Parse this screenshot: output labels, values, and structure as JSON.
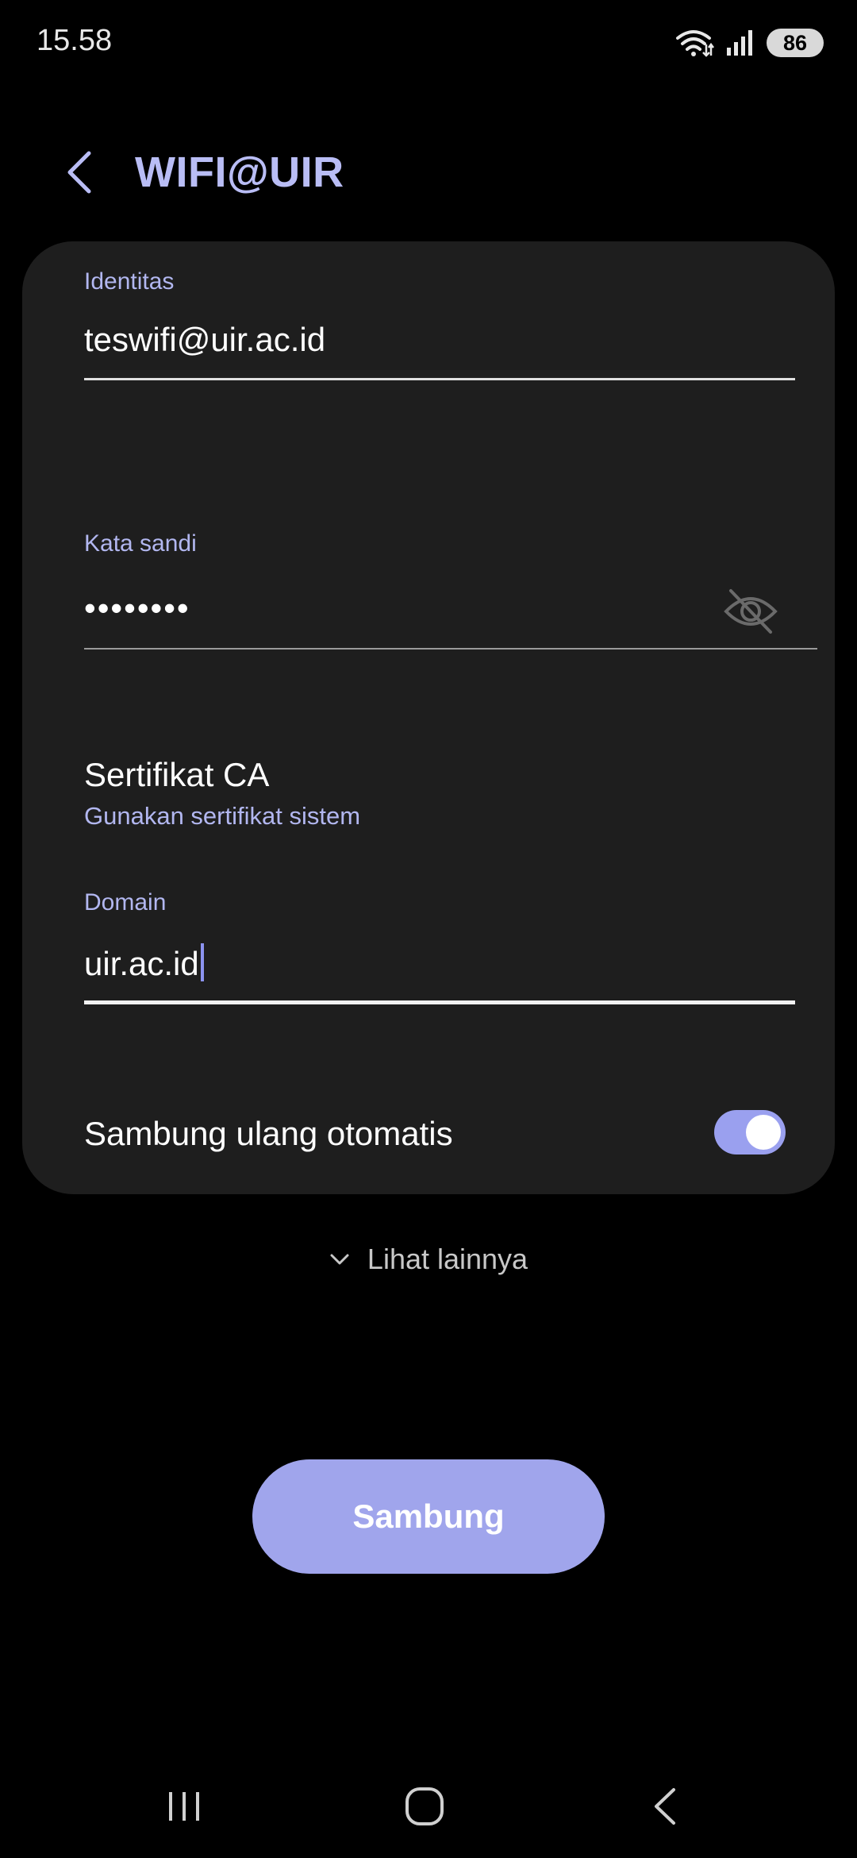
{
  "status_bar": {
    "time": "15.58",
    "battery": "86",
    "icons": [
      "wifi-icon",
      "signal-icon",
      "battery-icon"
    ]
  },
  "header": {
    "title": "WIFI@UIR",
    "back_icon": "back-arrow-icon"
  },
  "form": {
    "identity": {
      "label": "Identitas",
      "value": "teswifi@uir.ac.id"
    },
    "password": {
      "label": "Kata sandi",
      "value": "••••••••",
      "toggle_icon": "eye-off-icon"
    },
    "ca_certificate": {
      "title": "Sertifikat CA",
      "value": "Gunakan sertifikat sistem"
    },
    "domain": {
      "label": "Domain",
      "value": "uir.ac.id"
    },
    "auto_reconnect": {
      "label": "Sambung ulang otomatis",
      "enabled": true
    }
  },
  "see_more": {
    "label": "Lihat lainnya",
    "icon": "chevron-down-icon"
  },
  "connect_button": {
    "label": "Sambung"
  },
  "nav_bar": {
    "recents_icon": "recents-icon",
    "home_icon": "home-icon",
    "back_icon": "nav-back-icon"
  },
  "colors": {
    "accent": "#b9bdf5",
    "button": "#a0a5ec",
    "card": "#1e1e1e",
    "background": "#000000"
  }
}
